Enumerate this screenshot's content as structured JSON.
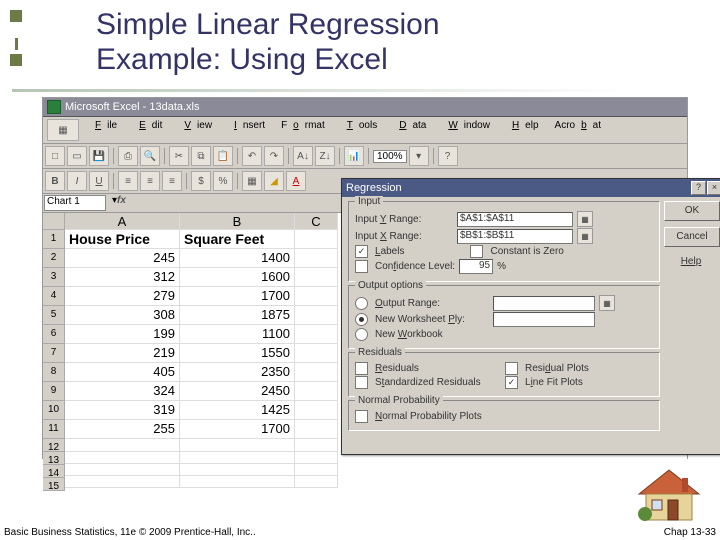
{
  "domain": "Computer-Use",
  "slide": {
    "title_line1": "Simple Linear Regression",
    "title_line2": "Example:  Using Excel",
    "footer_left": "Basic Business Statistics, 11e © 2009 Prentice-Hall, Inc..",
    "footer_right": "Chap 13-33"
  },
  "excel": {
    "window_title": "Microsoft Excel - 13data.xls",
    "menu": [
      "File",
      "Edit",
      "View",
      "Insert",
      "Format",
      "Tools",
      "Data",
      "Window",
      "Help",
      "Acrobat"
    ],
    "zoom": "100%",
    "namebox": "Chart 1",
    "columns": [
      "A",
      "B",
      "C"
    ],
    "rowNums": [
      "1",
      "2",
      "3",
      "4",
      "5",
      "6",
      "7",
      "8",
      "9",
      "10",
      "11",
      "12",
      "13",
      "14",
      "15"
    ],
    "headers": {
      "A": "House Price",
      "B": "Square Feet"
    },
    "data": [
      {
        "A": "245",
        "B": "1400"
      },
      {
        "A": "312",
        "B": "1600"
      },
      {
        "A": "279",
        "B": "1700"
      },
      {
        "A": "308",
        "B": "1875"
      },
      {
        "A": "199",
        "B": "1100"
      },
      {
        "A": "219",
        "B": "1550"
      },
      {
        "A": "405",
        "B": "2350"
      },
      {
        "A": "324",
        "B": "2450"
      },
      {
        "A": "319",
        "B": "1425"
      },
      {
        "A": "255",
        "B": "1700"
      }
    ]
  },
  "dialog": {
    "title": "Regression",
    "buttons": {
      "ok": "OK",
      "cancel": "Cancel",
      "help": "Help"
    },
    "input": {
      "group": "Input",
      "yrange_label": "Input Y Range:",
      "yrange_value": "$A$1:$A$11",
      "xrange_label": "Input X Range:",
      "xrange_value": "$B$1:$B$11",
      "labels_cb": "Labels",
      "constant_cb": "Constant is Zero",
      "conf_cb": "Confidence Level:",
      "conf_value": "95",
      "conf_pct": "%"
    },
    "output": {
      "group": "Output options",
      "range_rb": "Output Range:",
      "newws_rb": "New Worksheet Ply:",
      "newwb_rb": "New Workbook"
    },
    "residuals": {
      "group": "Residuals",
      "res_cb": "Residuals",
      "std_cb": "Standardized Residuals",
      "plot_cb": "Residual Plots",
      "line_cb": "Line Fit Plots"
    },
    "normal": {
      "group": "Normal Probability",
      "np_cb": "Normal Probability Plots"
    }
  }
}
